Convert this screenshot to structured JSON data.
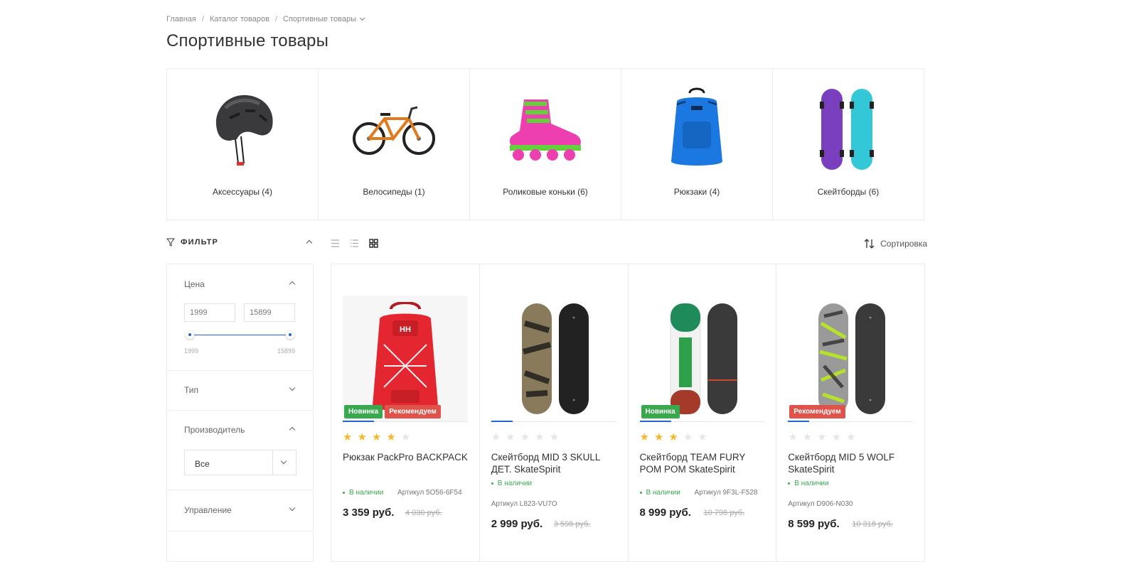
{
  "breadcrumb": {
    "home": "Главная",
    "catalog": "Каталог товаров",
    "current": "Спортивные товары"
  },
  "page_title": "Спортивные товары",
  "categories": [
    {
      "label": "Аксессуары (4)",
      "icon": "helmet-image"
    },
    {
      "label": "Велосипеды (1)",
      "icon": "bicycle-image"
    },
    {
      "label": "Роликовые коньки (6)",
      "icon": "roller-skate-image"
    },
    {
      "label": "Рюкзаки (4)",
      "icon": "backpack-image"
    },
    {
      "label": "Скейтборды (6)",
      "icon": "skateboard-image"
    }
  ],
  "filter": {
    "title": "ФИЛЬТР",
    "price": {
      "label": "Цена",
      "min": "1999",
      "max": "15899",
      "range_min": "1999",
      "range_max": "15899"
    },
    "type": {
      "label": "Тип"
    },
    "manufacturer": {
      "label": "Производитель",
      "selected": "Все"
    },
    "control": {
      "label": "Управление"
    }
  },
  "toolbar": {
    "sort_label": "Сортировка"
  },
  "products": [
    {
      "name": "Рюкзак PackPro BACKPACK",
      "badges": [
        "Новинка",
        "Рекомендуем"
      ],
      "rating": 4,
      "stock": "В наличии",
      "article": "Артикул 5O56-6F54",
      "price": "3 359 руб.",
      "old_price": "4 030 руб.",
      "image_progress": 0.25
    },
    {
      "name": "Скейтборд MID 3 SKULL ДЕТ. SkateSpirit",
      "badges": [],
      "rating": 0,
      "stock": "В наличии",
      "article": "Артикул L823-VU7O",
      "price": "2 999 руб.",
      "old_price": "3 598 руб.",
      "image_progress": 0.17
    },
    {
      "name": "Скейтборд TEAM FURY POM POM SkateSpirit",
      "badges": [
        "Новинка"
      ],
      "rating": 3,
      "stock": "В наличии",
      "article": "Артикул 9F3L-F528",
      "price": "8 999 руб.",
      "old_price": "10 798 руб.",
      "image_progress": 0.25
    },
    {
      "name": "Скейтборд MID 5 WOLF SkateSpirit",
      "badges": [
        "Рекомендуем"
      ],
      "rating": 0,
      "stock": "В наличии",
      "article": "Артикул D906-N030",
      "price": "8 599 руб.",
      "old_price": "10 318 руб.",
      "image_progress": 0.17
    }
  ],
  "colors": {
    "accent": "#2464d6",
    "new_badge": "#3aa84f",
    "recommend_badge": "#e0534a",
    "star": "#f5b82e"
  }
}
